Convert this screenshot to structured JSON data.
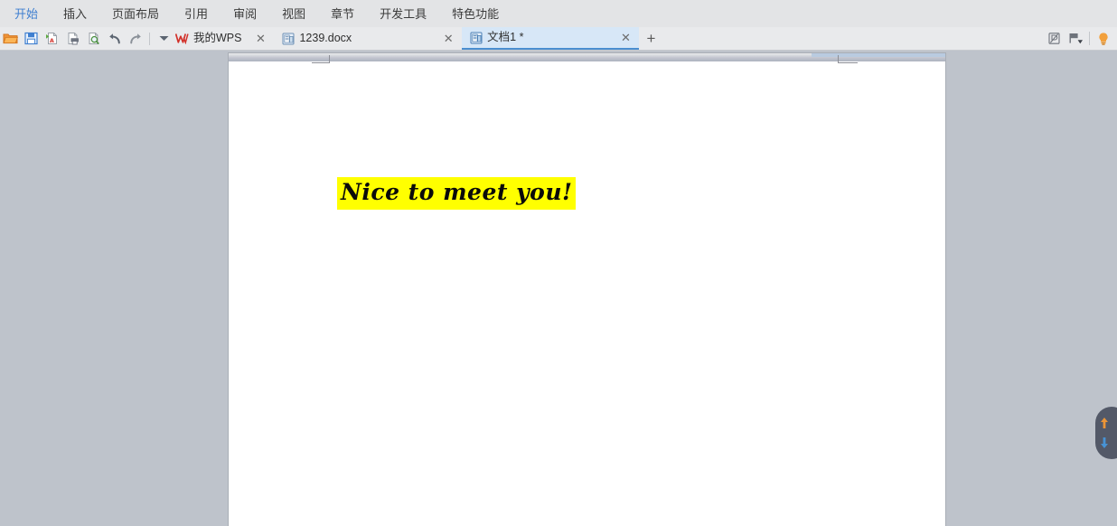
{
  "window": {
    "accent_blue": "#5b8fd4",
    "accent_red": "#e08a87",
    "background": "#bec3cb"
  },
  "menubar": {
    "items": [
      {
        "label": "开始",
        "active": true
      },
      {
        "label": "插入",
        "active": false
      },
      {
        "label": "页面布局",
        "active": false
      },
      {
        "label": "引用",
        "active": false
      },
      {
        "label": "审阅",
        "active": false
      },
      {
        "label": "视图",
        "active": false
      },
      {
        "label": "章节",
        "active": false
      },
      {
        "label": "开发工具",
        "active": false
      },
      {
        "label": "特色功能",
        "active": false
      }
    ]
  },
  "quick_access": {
    "tools": [
      {
        "name": "open-icon",
        "title": "打开"
      },
      {
        "name": "save-icon",
        "title": "保存"
      },
      {
        "name": "export-pdf-icon",
        "title": "输出为PDF"
      },
      {
        "name": "print-icon",
        "title": "打印"
      },
      {
        "name": "print-preview-icon",
        "title": "打印预览"
      },
      {
        "name": "undo-icon",
        "title": "撤销"
      },
      {
        "name": "redo-icon",
        "title": "恢复"
      }
    ],
    "caret": "▾"
  },
  "doc_tabs": {
    "tabs": [
      {
        "label": "我的WPS",
        "icon": "wps-logo-icon",
        "close": "✕",
        "active": false,
        "modified": false
      },
      {
        "label": "1239.docx",
        "icon": "docx-file-icon",
        "close": "✕",
        "active": false,
        "modified": false
      },
      {
        "label": "文档1 *",
        "icon": "docx-file-icon",
        "close": "✕",
        "active": true,
        "modified": true
      }
    ],
    "add_label": "+"
  },
  "right_tools": {
    "items": [
      {
        "name": "doc-compat-icon"
      },
      {
        "name": "flag-dropdown-icon"
      },
      {
        "name": "bulb-tips-icon"
      }
    ]
  },
  "document": {
    "page_text": "Nice to meet you!",
    "highlight_color": "#ffff00",
    "text_color": "#0a0a0a"
  },
  "nav_fab": {
    "up_arrow": "▲",
    "down_arrow": "▼",
    "up_color": "#f0922b",
    "down_color": "#3d8fd6"
  }
}
